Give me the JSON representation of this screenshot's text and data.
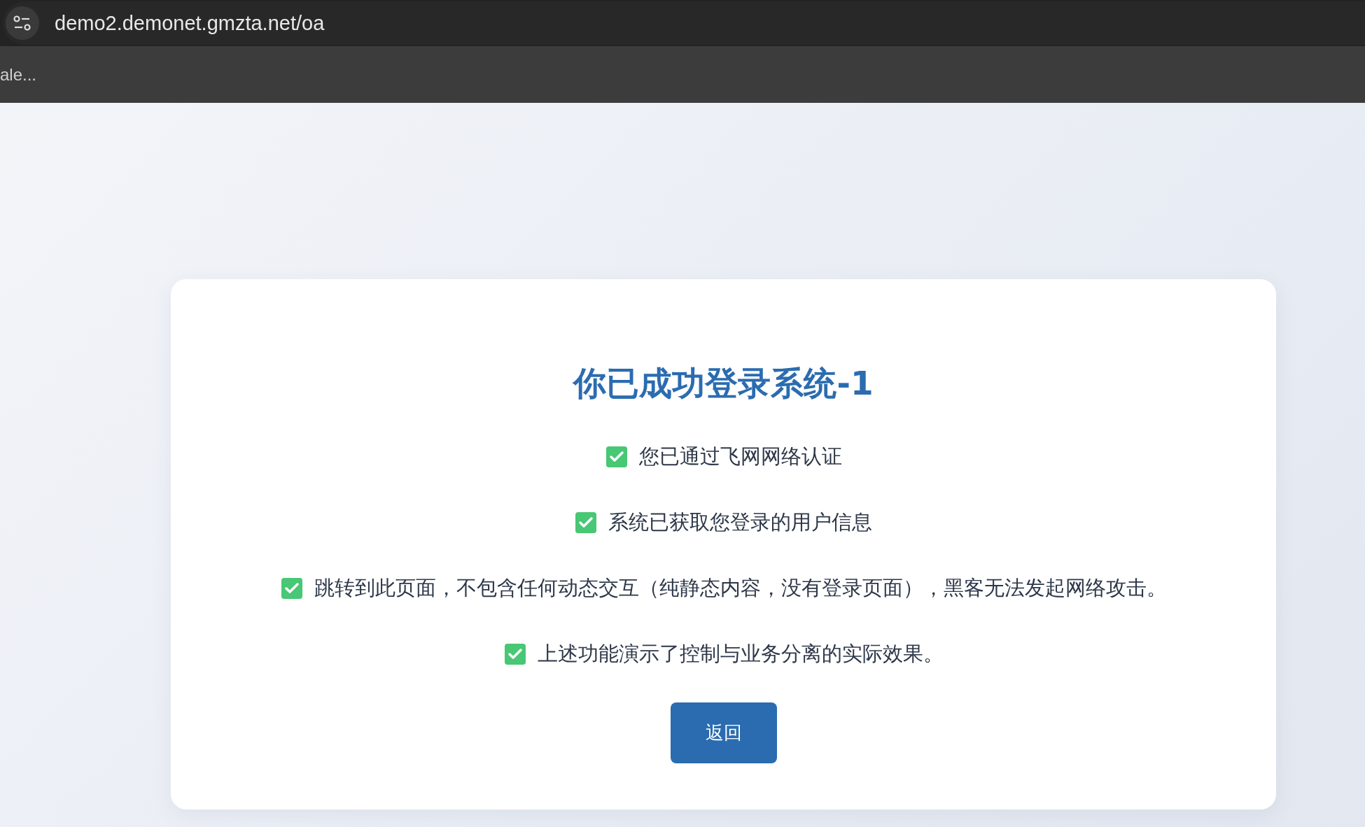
{
  "browser": {
    "url": "demo2.demonet.gmzta.net/oa",
    "bookmark": "ale..."
  },
  "card": {
    "title": "你已成功登录系统-1",
    "items": [
      "您已通过飞网网络认证",
      "系统已获取您登录的用户信息",
      "跳转到此页面，不包含任何动态交互（纯静态内容，没有登录页面），黑客无法发起网络攻击。",
      "上述功能演示了控制与业务分离的实际效果。"
    ],
    "button": "返回"
  }
}
